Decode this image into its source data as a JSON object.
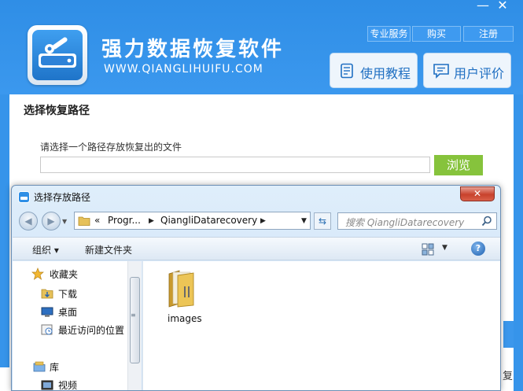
{
  "app": {
    "title": "强力数据恢复软件",
    "website": "WWW.QIANGLIHUIFU.COM",
    "window_controls": {
      "minimize": "—",
      "close": "✕"
    },
    "top_links": [
      "专业服务",
      "购买",
      "注册"
    ],
    "big_buttons": [
      {
        "label": "使用教程",
        "icon": "document-icon"
      },
      {
        "label": "用户评价",
        "icon": "comment-icon"
      }
    ],
    "section_title": "选择恢复路径",
    "path_label": "请选择一个路径存放恢复出的文件",
    "path_value": "",
    "browse_label": "浏览",
    "edge_text": "复",
    "colors": {
      "header_blue": "#3694ea",
      "browse_green": "#86c33c"
    }
  },
  "dialog": {
    "title": "选择存放路径",
    "close_glyph": "✕",
    "address": {
      "prefix": "«",
      "segments": [
        "Progr...",
        "QiangliDatarecovery"
      ]
    },
    "search_placeholder": "搜索 QiangliDatarecovery",
    "toolbar": {
      "organize": "组织 ▾",
      "new_folder": "新建文件夹",
      "help": "?"
    },
    "nav_items": [
      {
        "label": "收藏夹",
        "icon": "star-icon"
      },
      {
        "label": "下载",
        "icon": "download-folder-icon"
      },
      {
        "label": "桌面",
        "icon": "desktop-icon"
      },
      {
        "label": "最近访问的位置",
        "icon": "recent-places-icon"
      },
      {
        "label": "库",
        "icon": "library-icon"
      },
      {
        "label": "视频",
        "icon": "video-icon"
      }
    ],
    "files": [
      {
        "name": "images",
        "icon": "folder-icon"
      }
    ]
  }
}
